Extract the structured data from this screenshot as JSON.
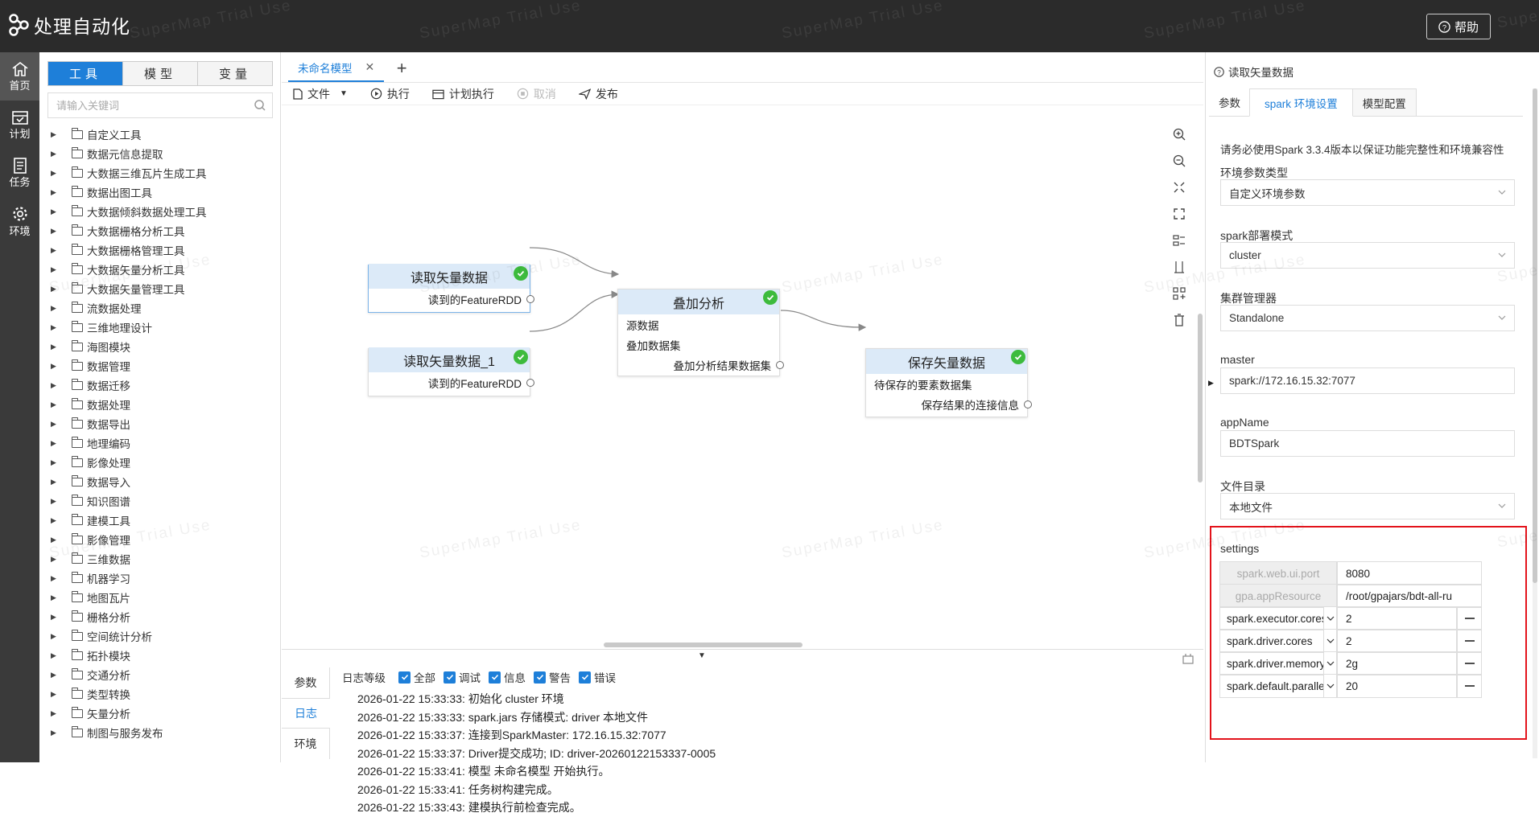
{
  "app": {
    "title": "处理自动化",
    "help_label": "帮助"
  },
  "rail": [
    {
      "label": "首页",
      "icon": "home-icon"
    },
    {
      "label": "计划",
      "icon": "calendar-icon"
    },
    {
      "label": "任务",
      "icon": "list-icon"
    },
    {
      "label": "环境",
      "icon": "gear-icon"
    }
  ],
  "left": {
    "tabs": [
      "工具",
      "模型",
      "变量"
    ],
    "active_tab": "工具",
    "search_placeholder": "请输入关键词",
    "tree": [
      "自定义工具",
      "数据元信息提取",
      "大数据三维瓦片生成工具",
      "数据出图工具",
      "大数据倾斜数据处理工具",
      "大数据栅格分析工具",
      "大数据栅格管理工具",
      "大数据矢量分析工具",
      "大数据矢量管理工具",
      "流数据处理",
      "三维地理设计",
      "海图模块",
      "数据管理",
      "数据迁移",
      "数据处理",
      "数据导出",
      "地理编码",
      "影像处理",
      "数据导入",
      "知识图谱",
      "建模工具",
      "影像管理",
      "三维数据",
      "机器学习",
      "地图瓦片",
      "栅格分析",
      "空间统计分析",
      "拓扑模块",
      "交通分析",
      "类型转换",
      "矢量分析",
      "制图与服务发布"
    ]
  },
  "center": {
    "tab_label": "未命名模型",
    "toolbar": {
      "file": "文件",
      "run": "执行",
      "schedule": "计划执行",
      "cancel": "取消",
      "publish": "发布"
    },
    "nodes": {
      "read1": {
        "title": "读取矢量数据",
        "out": "读到的FeatureRDD"
      },
      "read2": {
        "title": "读取矢量数据_1",
        "out": "读到的FeatureRDD"
      },
      "overlay": {
        "title": "叠加分析",
        "in1": "源数据",
        "in2": "叠加数据集",
        "out": "叠加分析结果数据集"
      },
      "save": {
        "title": "保存矢量数据",
        "in": "待保存的要素数据集",
        "out": "保存结果的连接信息"
      }
    },
    "bottom": {
      "tabs": [
        "参数",
        "日志",
        "环境"
      ],
      "active_tab": "日志",
      "level_label": "日志等级",
      "levels": [
        "全部",
        "调试",
        "信息",
        "警告",
        "错误"
      ],
      "logs": [
        "2026-01-22 15:33:33: 初始化 cluster 环境",
        "2026-01-22 15:33:33: spark.jars 存储模式: driver 本地文件",
        "2026-01-22 15:33:37: 连接到SparkMaster: 172.16.15.32:7077",
        "2026-01-22 15:33:37: Driver提交成功; ID: driver-20260122153337-0005",
        "2026-01-22 15:33:41: 模型 未命名模型 开始执行。",
        "2026-01-22 15:33:41: 任务树构建完成。",
        "2026-01-22 15:33:43: 建模执行前检查完成。"
      ]
    }
  },
  "right": {
    "title": "读取矢量数据",
    "tabs": [
      "参数",
      "spark 环境设置",
      "模型配置"
    ],
    "active_tab": "spark 环境设置",
    "note": "请务必使用Spark 3.3.4版本以保证功能完整性和环境兼容性",
    "fields": {
      "env_type": {
        "label": "环境参数类型",
        "value": "自定义环境参数"
      },
      "deploy_mode": {
        "label": "spark部署模式",
        "value": "cluster"
      },
      "cluster_manager": {
        "label": "集群管理器",
        "value": "Standalone"
      },
      "master": {
        "label": "master",
        "value": "spark://172.16.15.32:7077"
      },
      "app_name": {
        "label": "appName",
        "value": "BDTSpark"
      },
      "file_dir": {
        "label": "文件目录",
        "value": "本地文件"
      }
    },
    "settings_label": "settings",
    "settings": [
      {
        "key": "spark.web.ui.port",
        "value": "8080",
        "locked": true
      },
      {
        "key": "gpa.appResource",
        "value": "/root/gpajars/bdt-all-ru",
        "locked": true
      },
      {
        "key": "spark.executor.cores",
        "value": "2",
        "locked": false
      },
      {
        "key": "spark.driver.cores",
        "value": "2",
        "locked": false
      },
      {
        "key": "spark.driver.memory",
        "value": "2g",
        "locked": false
      },
      {
        "key": "spark.default.paralleli",
        "value": "20",
        "locked": false
      }
    ]
  },
  "watermark": "SuperMap Trial Use",
  "colors": {
    "accent": "#1e7fd9",
    "topbar": "#2b2b2b",
    "highlight_box": "#e3131b",
    "success": "#3dbb3d",
    "node_header": "#dceaf8"
  }
}
